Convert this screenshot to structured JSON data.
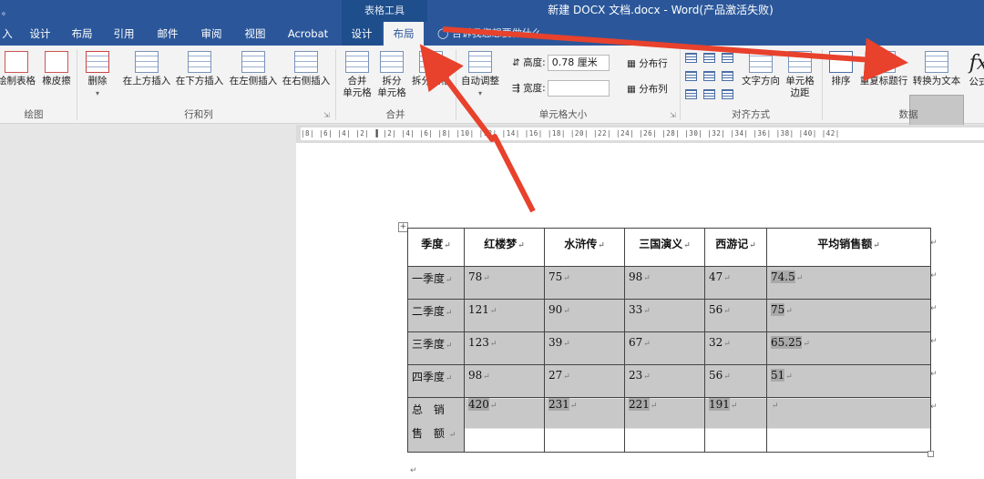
{
  "window": {
    "left_fragment": "。",
    "context_label": "表格工具",
    "title": "新建 DOCX 文档.docx - Word(产品激活失败)"
  },
  "tabs": [
    {
      "label": "入"
    },
    {
      "label": "设计"
    },
    {
      "label": "布局"
    },
    {
      "label": "引用"
    },
    {
      "label": "邮件"
    },
    {
      "label": "审阅"
    },
    {
      "label": "视图"
    },
    {
      "label": "Acrobat"
    },
    {
      "label": "设计"
    },
    {
      "label": "布局"
    }
  ],
  "tell_me": "告诉我您想要做什么...",
  "ribbon": {
    "draw": {
      "draw_table": "绘制表格",
      "eraser": "橡皮擦",
      "group": "绘图"
    },
    "rows_cols": {
      "delete": "删除",
      "insert_above": "在上方插入",
      "insert_below": "在下方插入",
      "insert_left": "在左侧插入",
      "insert_right": "在右侧插入",
      "group": "行和列"
    },
    "merge": {
      "merge_cells_1": "合并",
      "merge_cells_2": "单元格",
      "split_cells_1": "拆分",
      "split_cells_2": "单元格",
      "split_table": "拆分表格",
      "group": "合并"
    },
    "cell_size": {
      "autofit": "自动调整",
      "height_label": "高度:",
      "height_value": "0.78 厘米",
      "width_label": "宽度:",
      "width_value": "",
      "distribute_rows": "分布行",
      "distribute_cols": "分布列",
      "group": "单元格大小"
    },
    "alignment": {
      "text_direction": "文字方向",
      "cell_margins_1": "单元格",
      "cell_margins_2": "边距",
      "group": "对齐方式"
    },
    "data": {
      "sort": "排序",
      "repeat_header": "重复标题行",
      "convert_to_text": "转换为文本",
      "formula": "公式",
      "group": "数据"
    }
  },
  "ruler_text": "|8|  |6|  |4|  |2|  ▐  |2|  |4|  |6|  |8|  |10|  |12|  |14|  |16|  |18|  |20|  |22|  |24|  |26|  |28|  |30|  |32|  |34|  |36|  |38|  |40|  |42|",
  "table": {
    "headers": [
      "季度",
      "红楼梦",
      "水浒传",
      "三国演义",
      "西游记",
      "平均销售额"
    ],
    "rows": [
      [
        "一季度",
        "78",
        "75",
        "98",
        "47",
        "74.5"
      ],
      [
        "二季度",
        "121",
        "90",
        "33",
        "56",
        "75"
      ],
      [
        "三季度",
        "123",
        "39",
        "67",
        "32",
        "65.25"
      ],
      [
        "四季度",
        "98",
        "27",
        "23",
        "56",
        "51"
      ],
      [
        "总 销 售 额",
        "420",
        "231",
        "221",
        "191",
        ""
      ]
    ]
  },
  "colors": {
    "title_blue": "#2b579a",
    "context_blue": "#1e4e8c",
    "arrow_red": "#e8412c",
    "cell_shade": "#c8c8c8"
  }
}
